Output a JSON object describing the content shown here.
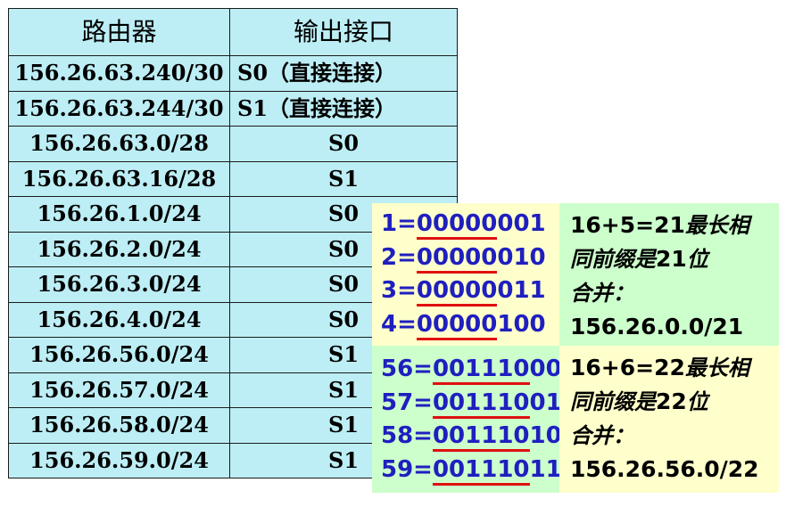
{
  "table": {
    "headers": [
      "路由器",
      "输出接口"
    ],
    "rows": [
      {
        "route": "156.26.63.240/30",
        "iface": "S0（直接连接）"
      },
      {
        "route": "156.26.63.244/30",
        "iface": "S1（直接连接）"
      },
      {
        "route": "156.26.63.0/28",
        "iface": "S0"
      },
      {
        "route": "156.26.63.16/28",
        "iface": "S1"
      },
      {
        "route": "156.26.1.0/24",
        "iface": "S0"
      },
      {
        "route": "156.26.2.0/24",
        "iface": "S0"
      },
      {
        "route": "156.26.3.0/24",
        "iface": "S0"
      },
      {
        "route": "156.26.4.0/24",
        "iface": "S0"
      },
      {
        "route": "156.26.56.0/24",
        "iface": "S1"
      },
      {
        "route": "156.26.57.0/24",
        "iface": "S1"
      },
      {
        "route": "156.26.58.0/24",
        "iface": "S1"
      },
      {
        "route": "156.26.59.0/24",
        "iface": "S1"
      }
    ]
  },
  "group1": {
    "binary": [
      {
        "prefix": "1=",
        "underlined": "00000",
        "rest": "001"
      },
      {
        "prefix": "2=",
        "underlined": "00000",
        "rest": "010"
      },
      {
        "prefix": "3=",
        "underlined": "00000",
        "rest": "011"
      },
      {
        "prefix": "4=",
        "underlined": "00000",
        "rest": "100"
      }
    ],
    "note": {
      "line1_sum": "16+5=21",
      "line1_text": "最长相",
      "line2_text": "同前缀是",
      "line2_num": "21",
      "line2_tail": "位",
      "line3": "合并：",
      "line4": "156.26.0.0/21"
    }
  },
  "group2": {
    "binary": [
      {
        "prefix": "56=",
        "underlined": "001110",
        "rest": "00"
      },
      {
        "prefix": "57=",
        "underlined": "001110",
        "rest": "01"
      },
      {
        "prefix": "58=",
        "underlined": "001110",
        "rest": "10"
      },
      {
        "prefix": "59=",
        "underlined": "001110",
        "rest": "11"
      }
    ],
    "note": {
      "line1_sum": "16+6=22",
      "line1_text": "最长相",
      "line2_text": "同前缀是",
      "line2_num": "22",
      "line2_tail": "位",
      "line3": "合并：",
      "line4": "156.26.56.0/22"
    }
  },
  "colors": {
    "table_bg": "#bdeef5",
    "group1_binary_bg": "#ffffcc",
    "group1_note_bg": "#ccffcc",
    "group2_binary_bg": "#ccffcc",
    "group2_note_bg": "#ffffcc",
    "binary_text": "#1f1fbf",
    "underline": "#e01010"
  }
}
